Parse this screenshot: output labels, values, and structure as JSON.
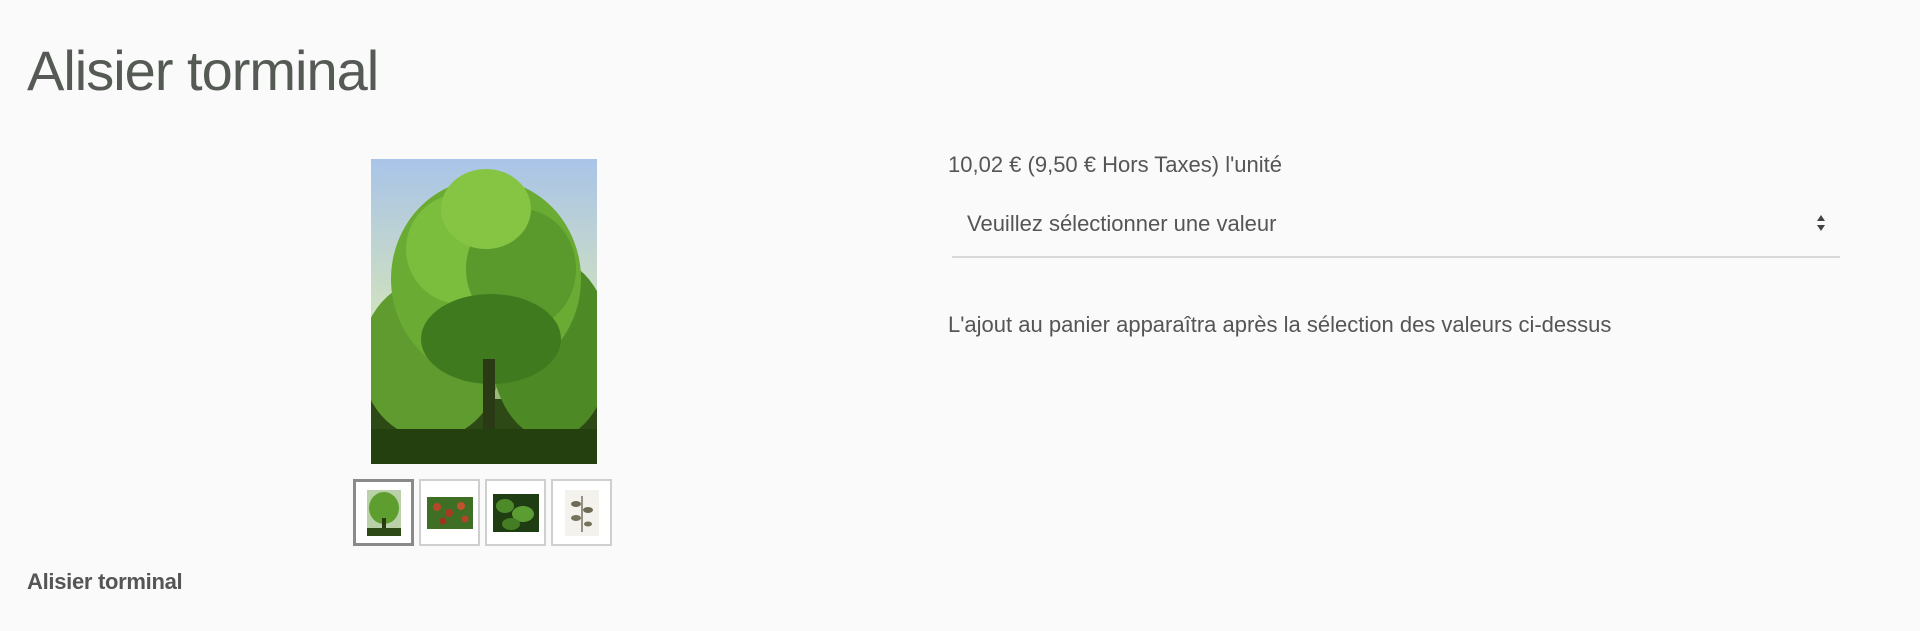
{
  "product": {
    "title": "Alisier torminal",
    "subtitle": "Alisier torminal",
    "price_text": "10,02 € (9,50 € Hors Taxes) l'unité"
  },
  "gallery": {
    "main_image": "tree-photo",
    "thumbnails": [
      {
        "name": "thumbnail-tree",
        "active": true
      },
      {
        "name": "thumbnail-berries",
        "active": false
      },
      {
        "name": "thumbnail-foliage",
        "active": false
      },
      {
        "name": "thumbnail-herbarium",
        "active": false
      }
    ]
  },
  "variant_select": {
    "placeholder": "Veuillez sélectionner une valeur"
  },
  "cart_notice": "L'ajout au panier apparaîtra après la sélection des valeurs ci-dessus"
}
